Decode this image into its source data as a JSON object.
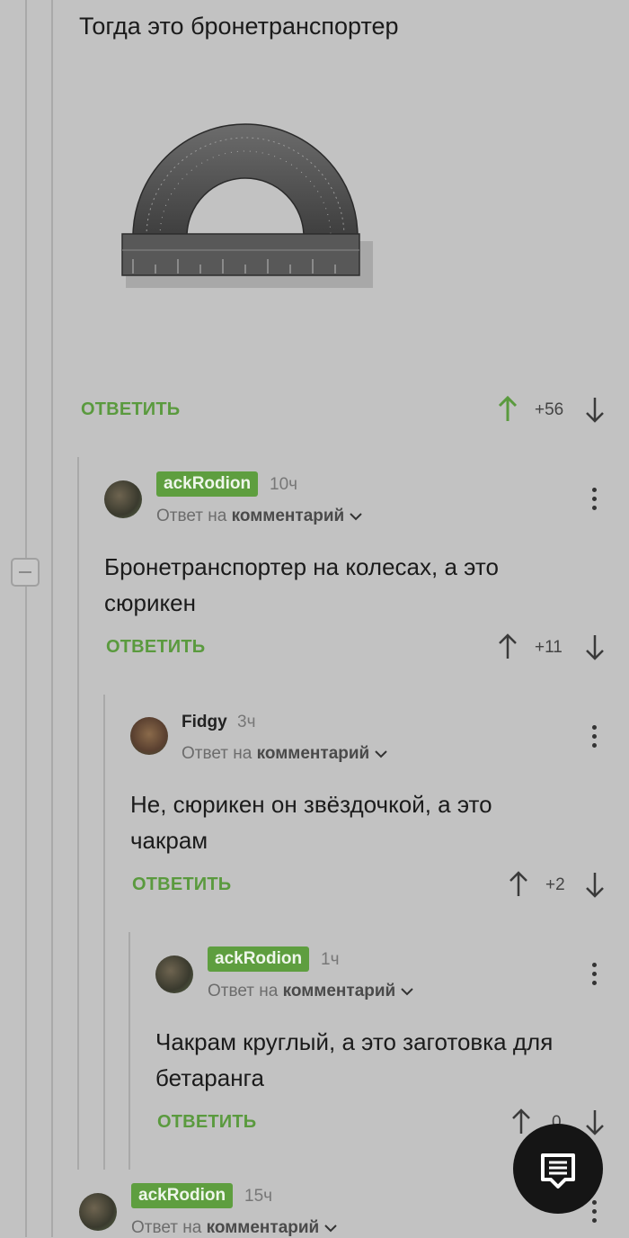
{
  "top_comment": {
    "text": "Тогда это бронетранспортер",
    "reply_label": "ОТВЕТИТЬ",
    "score": "+56"
  },
  "comments": [
    {
      "username": "ackRodion",
      "time": "10ч",
      "reply_to_prefix": "Ответ на",
      "reply_to_link": "комментарий",
      "text": "Бронетранспортер на колесах, а это сюрикен",
      "reply_label": "ОТВЕТИТЬ",
      "score": "+11"
    },
    {
      "username": "Fidgy",
      "time": "3ч",
      "reply_to_prefix": "Ответ на",
      "reply_to_link": "комментарий",
      "text": "Не, сюрикен он звёздочкой, а это чакрам",
      "reply_label": "ОТВЕТИТЬ",
      "score": "+2"
    },
    {
      "username": "ackRodion",
      "time": "1ч",
      "reply_to_prefix": "Ответ на",
      "reply_to_link": "комментарий",
      "text": "Чакрам круглый, а это заготовка для бетаранга",
      "reply_label": "ОТВЕТИТЬ",
      "score": "0"
    },
    {
      "username": "ackRodion",
      "time": "15ч",
      "reply_to_prefix": "Ответ на",
      "reply_to_link": "комментарий"
    }
  ],
  "colors": {
    "background": "#c2c2c2",
    "accent_green": "#5e9e3f",
    "fab": "#151515"
  },
  "icons": [
    "arrow-up-icon",
    "arrow-down-icon",
    "chevron-down-icon",
    "more-vertical-icon",
    "collapse-minus-icon",
    "comment-icon"
  ]
}
